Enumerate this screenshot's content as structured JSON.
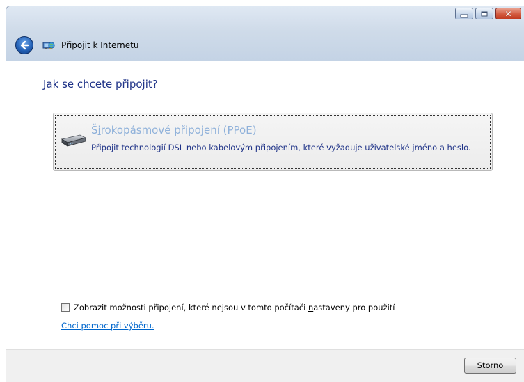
{
  "window": {
    "title": "Připojit k Internetu",
    "controls": {
      "close_glyph": "✕"
    }
  },
  "main": {
    "heading": "Jak se chcete připojit?",
    "options": [
      {
        "title_pre": "Š",
        "title_underlined": "i",
        "title_post": "rokopásmové připojení (PPoE)",
        "description": "Připojit technologií DSL nebo kabelovým připojením, které vyžaduje uživatelské jméno a heslo.",
        "icon": "modem-icon"
      }
    ],
    "checkbox": {
      "checked": false,
      "label_pre": "Zobrazit možnosti připojení, které nejsou v tomto počítači ",
      "label_underlined": "n",
      "label_post": "astaveny pro použití"
    },
    "help_link": "Chci pomoc při výběru."
  },
  "footer": {
    "cancel_label": "Storno"
  },
  "colors": {
    "heading": "#1e3287",
    "option_title": "#8fb1da",
    "link": "#0066cc",
    "footer_bg": "#f0f0f0"
  }
}
